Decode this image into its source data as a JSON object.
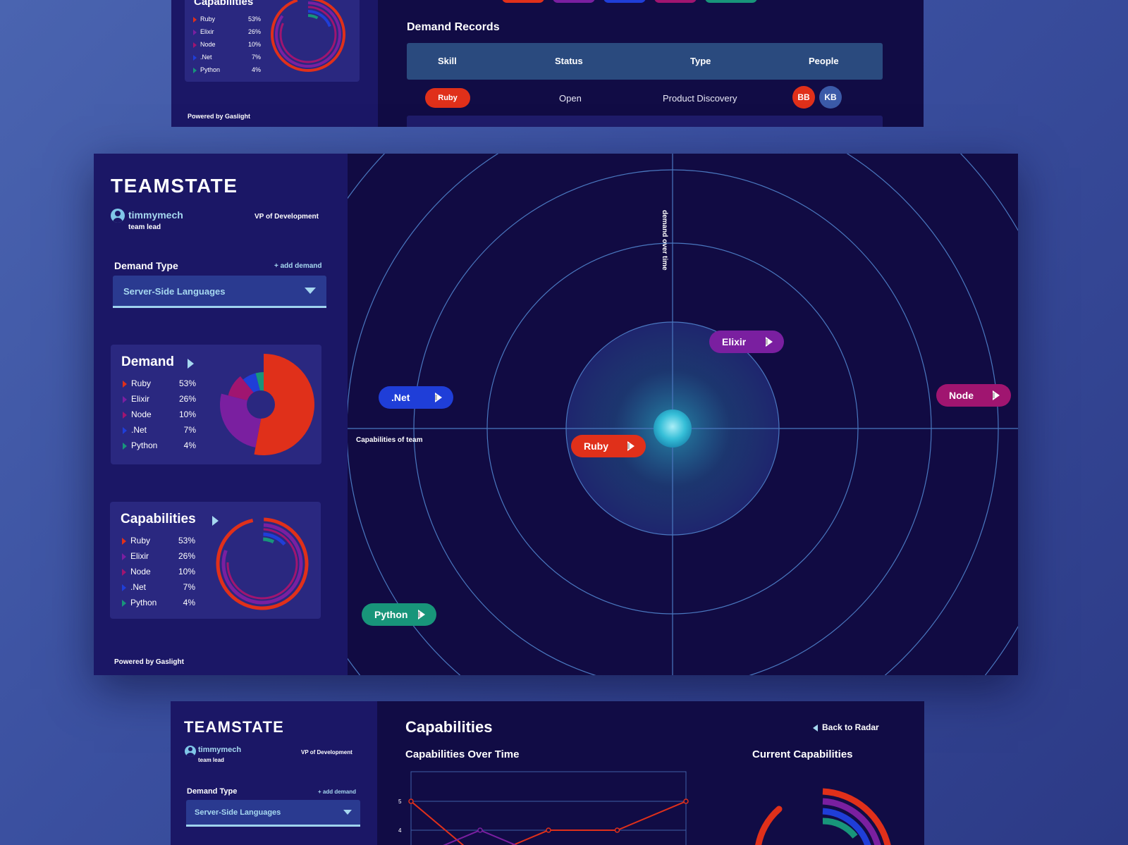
{
  "colors": {
    "ruby": "#e0301a",
    "elixir": "#7a1fa0",
    "node": "#a01570",
    "net": "#1f3ed8",
    "python": "#18957a",
    "accent": "#a6d8f0",
    "sidebar": "#1b1766",
    "main_bg": "#110b43"
  },
  "app": {
    "brand": "TEAMSTATE",
    "username": "timmymech",
    "user_role": "team lead",
    "job_title": "VP of Development",
    "powered_by": "Powered by Gaslight"
  },
  "demand_type": {
    "label": "Demand Type",
    "add_label": "+ add demand",
    "selected": "Server-Side Languages"
  },
  "skills": [
    {
      "name": "Ruby",
      "pct_label": "53%",
      "pct": 53,
      "color": "#e0301a"
    },
    {
      "name": "Elixir",
      "pct_label": "26%",
      "pct": 26,
      "color": "#7a1fa0"
    },
    {
      "name": "Node",
      "pct_label": "10%",
      "pct": 10,
      "color": "#a01570"
    },
    {
      "name": ".Net",
      "pct_label": "7%",
      "pct": 7,
      "color": "#1f3ed8"
    },
    {
      "name": "Python",
      "pct_label": "4%",
      "pct": 4,
      "color": "#18957a"
    }
  ],
  "demand_card": {
    "title": "Demand"
  },
  "capabilities_card": {
    "title": "Capabilities"
  },
  "radar": {
    "y_axis_label": "demand over time",
    "x_axis_label": "Capabilities of team",
    "pills": [
      {
        "name": "Elixir",
        "color": "#7a1fa0"
      },
      {
        "name": ".Net",
        "color": "#1f3ed8"
      },
      {
        "name": "Node",
        "color": "#a01570"
      },
      {
        "name": "Ruby",
        "color": "#e0301a"
      },
      {
        "name": "Python",
        "color": "#18957a"
      }
    ]
  },
  "records": {
    "title": "Demand Records",
    "columns": [
      "Skill",
      "Status",
      "Type",
      "People"
    ],
    "rows": [
      {
        "skill": "Ruby",
        "status": "Open",
        "type": "Product Discovery",
        "people": [
          "BB",
          "KB"
        ]
      }
    ]
  },
  "capabilities_page": {
    "title": "Capabilities",
    "back_label": "Back to Radar",
    "over_time_title": "Capabilities Over Time",
    "current_title": "Current Capabilities",
    "y_ticks": [
      "5",
      "4"
    ]
  },
  "chart_data": [
    {
      "type": "pie",
      "title": "Demand",
      "categories": [
        "Ruby",
        "Elixir",
        "Node",
        ".Net",
        "Python"
      ],
      "values": [
        53,
        26,
        10,
        7,
        4
      ]
    },
    {
      "type": "pie",
      "title": "Capabilities",
      "categories": [
        "Ruby",
        "Elixir",
        "Node",
        ".Net",
        "Python"
      ],
      "values": [
        53,
        26,
        10,
        7,
        4
      ]
    },
    {
      "type": "line",
      "title": "Capabilities Over Time",
      "ylim": [
        3.5,
        5.5
      ],
      "series": [
        {
          "name": "Ruby",
          "values": [
            5,
            3,
            4,
            4,
            5
          ]
        },
        {
          "name": "Elixir",
          "values": [
            3,
            4,
            3
          ]
        }
      ]
    }
  ]
}
